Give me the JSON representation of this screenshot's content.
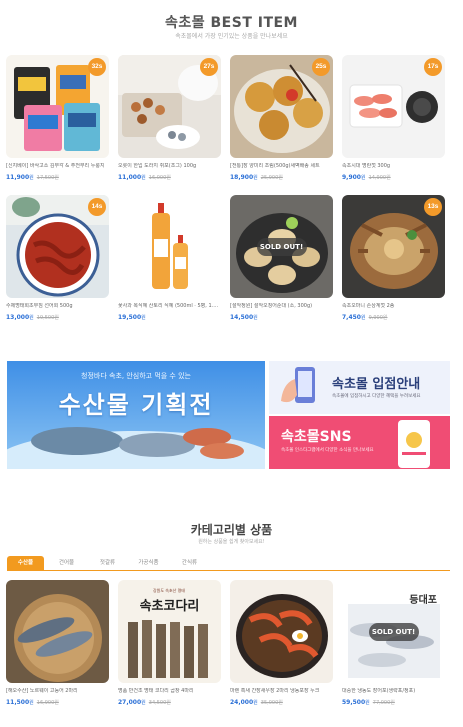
{
  "best": {
    "title": "속초몰 BEST ITEM",
    "subtitle": "속초몰에서 가장 인기있는 상품을 만나보세요"
  },
  "best_items": [
    {
      "name": "[신지베이] 바삭고소 김부각 & 주전부리 누룽지",
      "price": "11,900",
      "won": "원",
      "old": "17,500원",
      "badge": "32s",
      "sold_out": false
    },
    {
      "name": "오롯이 한입 도라지 쥐포(조그) 100g",
      "price": "11,000",
      "won": "원",
      "old": "16,000원",
      "badge": "27s",
      "sold_out": false
    },
    {
      "name": "[전통]장 양미리 조림(500g)새벽배송 세트",
      "price": "18,900",
      "won": "원",
      "old": "25,900원",
      "badge": "25s",
      "sold_out": false
    },
    {
      "name": "속초시대 명란젓 300g",
      "price": "9,900",
      "won": "원",
      "old": "14,900원",
      "badge": "17s",
      "sold_out": false
    },
    {
      "name": "수제명태회초무침 선어회 500g",
      "price": "13,000",
      "won": "원",
      "old": "19,500원",
      "badge": "14s",
      "sold_out": false
    },
    {
      "name": "꽃사과 복식혜 산토리 식혜 (500ml · 5병, 1.5L)",
      "price": "19,500",
      "won": "원",
      "old": "",
      "badge": "",
      "sold_out": false
    },
    {
      "name": "[설악정원] 설악오징어순대 (소, 300g)",
      "price": "14,500",
      "won": "원",
      "old": "",
      "badge": "",
      "sold_out": true
    },
    {
      "name": "속초오마니 손상계젓 2종",
      "price": "7,450",
      "won": "원",
      "old": "9,900원",
      "badge": "13s",
      "sold_out": false
    }
  ],
  "banners": {
    "big_line1": "청정바다 속초, 안심하고 먹을 수 있는",
    "big_line2": "수산물 기획전",
    "store_title": "속초몰 입점안내",
    "store_sub": "속초몰에 입점하시고 다양한 혜택을 누려보세요",
    "sns_title": "속초몰SNS",
    "sns_sub": "속초몰 인스타그램에서 다양한 소식을 만나보세요"
  },
  "category": {
    "title": "카테고리별 상품",
    "subtitle": "원하는 상품을 쉽게 찾아보세요!",
    "tabs": [
      "수산물",
      "건어물",
      "젓갈류",
      "가공식품",
      "간식류"
    ]
  },
  "category_items": [
    {
      "name": "[해오수산] 노르웨이 고등어 2마리",
      "price": "11,500",
      "won": "원",
      "old": "16,900원",
      "sold_out": false,
      "label": ""
    },
    {
      "name": "명품 반건조 명태 코다리 곱창 4마리",
      "price": "27,000",
      "won": "원",
      "old": "34,500원",
      "sold_out": false,
      "label": "속초코다리"
    },
    {
      "name": "마렌 흑새 간장새우장 2마리 냉동포장 누크",
      "price": "24,000",
      "won": "원",
      "old": "35,000원",
      "sold_out": false,
      "label": ""
    },
    {
      "name": "대중한 냉동도 장어포(생략포/정포)",
      "price": "59,500",
      "won": "원",
      "old": "77,000원",
      "sold_out": true,
      "label": "등대포"
    }
  ],
  "soldout_text": "SOLD OUT!",
  "colors": {
    "accent": "#f29a1f",
    "price": "#2a6fd6",
    "badge": "#f39a2a",
    "sns_pink": "#f04d74"
  }
}
